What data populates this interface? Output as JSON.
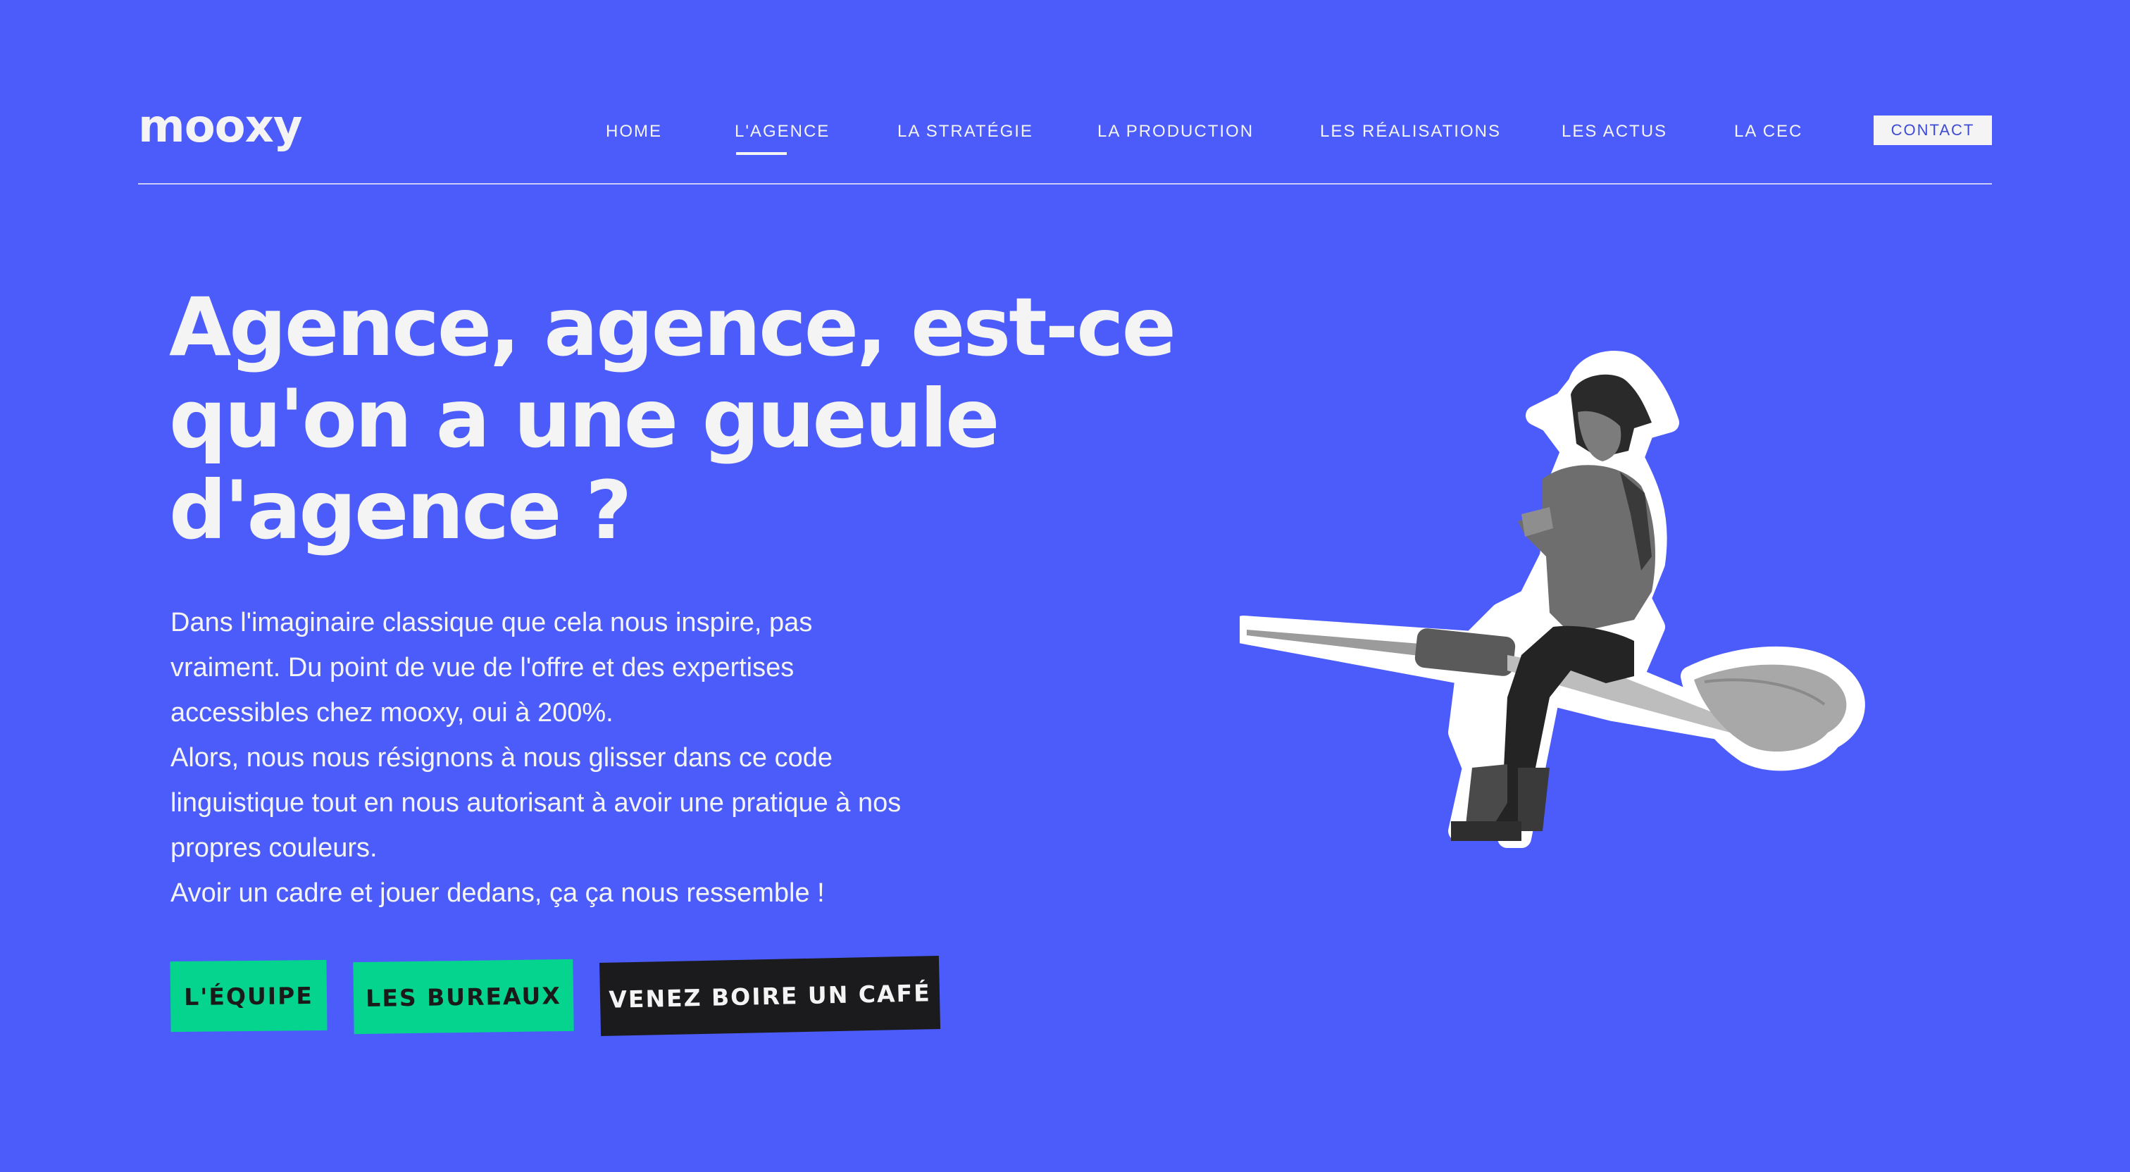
{
  "brand": {
    "logo_text": "mooxy"
  },
  "nav": {
    "items": [
      {
        "label": "HOME"
      },
      {
        "label": "L'AGENCE",
        "active": true
      },
      {
        "label": "LA STRATÉGIE"
      },
      {
        "label": "LA PRODUCTION"
      },
      {
        "label": "LES RÉALISATIONS"
      },
      {
        "label": "LES ACTUS"
      },
      {
        "label": "LA CEC"
      }
    ],
    "contact_label": "CONTACT"
  },
  "hero": {
    "title": "Agence, agence, est-ce qu'on a une gueule d'agence ?",
    "paragraphs": [
      "Dans l'imaginaire classique que cela nous inspire, pas vraiment. Du point de vue de l'offre et des expertises accessibles chez mooxy, oui à 200%.",
      "Alors, nous nous résignons à nous glisser dans ce code linguistique tout en nous autorisant à avoir une pratique à nos propres couleurs.",
      "Avoir un cadre et jouer dedans, ça ça nous ressemble !"
    ],
    "buttons": {
      "team": "L'ÉQUIPE",
      "offices": "LES BUREAUX",
      "coffee": "VENEZ BOIRE UN CAFÉ"
    }
  },
  "illustration": {
    "icon": "cowboy-riding-dart-illustration"
  },
  "colors": {
    "background": "#4c5cfb",
    "text": "#f4f4f4",
    "accent_green": "#05d48e",
    "dark": "#1b1b1d"
  }
}
